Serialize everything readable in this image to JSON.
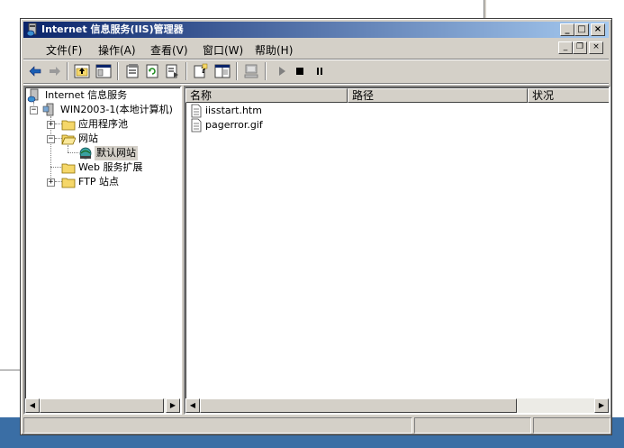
{
  "window": {
    "title": "Internet 信息服务(IIS)管理器"
  },
  "menu": [
    "文件(F)",
    "操作(A)",
    "查看(V)",
    "窗口(W)",
    "帮助(H)"
  ],
  "toolbar_icons": [
    "back-arrow-icon",
    "forward-arrow-icon",
    "up-folder-icon",
    "show-hide-tree-icon",
    "properties-icon",
    "refresh-icon",
    "export-list-icon",
    "help-icon",
    "console-tree-icon",
    "computer-icon",
    "start-icon",
    "stop-icon",
    "pause-icon"
  ],
  "tree": {
    "root": "Internet 信息服务",
    "computer": "WIN2003-1(本地计算机)",
    "app_pools": "应用程序池",
    "websites": "网站",
    "default_site": "默认网站",
    "web_ext": "Web 服务扩展",
    "ftp": "FTP 站点"
  },
  "list": {
    "columns": [
      "名称",
      "路径",
      "状况"
    ],
    "rows": [
      {
        "name": "iisstart.htm"
      },
      {
        "name": "pagerror.gif"
      }
    ]
  },
  "colors": {
    "title_start": "#0a246a",
    "title_end": "#a6caf0",
    "face": "#d4d0c8",
    "desktop": "#3a6ea5"
  }
}
